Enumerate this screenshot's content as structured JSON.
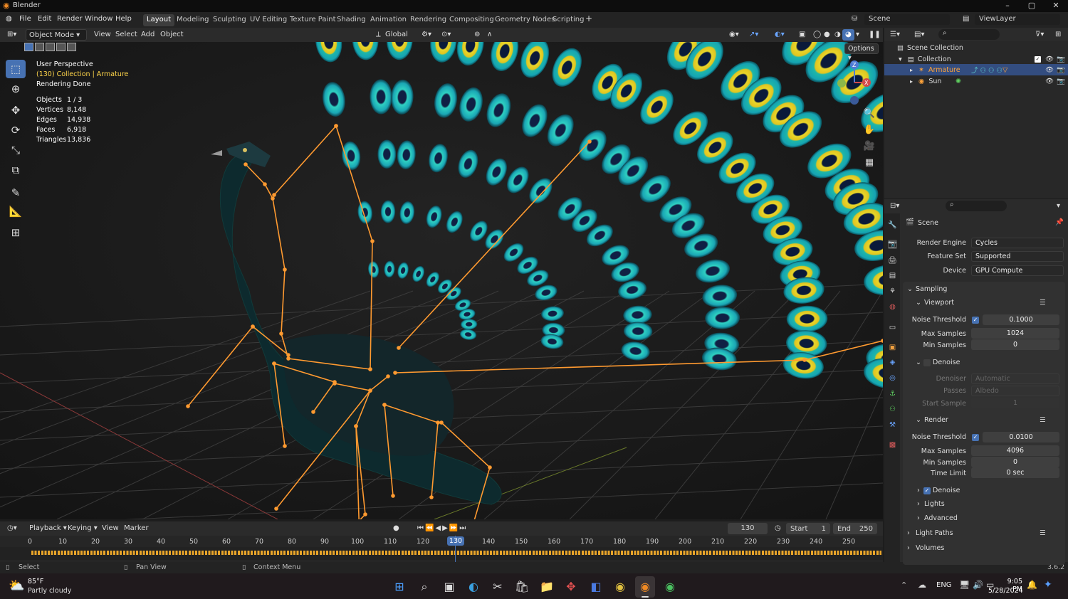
{
  "app": {
    "title": "Blender",
    "version": "3.6.2"
  },
  "menu": [
    "File",
    "Edit",
    "Render",
    "Window",
    "Help"
  ],
  "workspaces": [
    "Layout",
    "Modeling",
    "Sculpting",
    "UV Editing",
    "Texture Paint",
    "Shading",
    "Animation",
    "Rendering",
    "Compositing",
    "Geometry Nodes",
    "Scripting"
  ],
  "scene_name": "Scene",
  "view_layer": "ViewLayer",
  "viewport_header": {
    "mode": "Object Mode",
    "menus": [
      "View",
      "Select",
      "Add",
      "Object"
    ],
    "orientation": "Global",
    "options": "Options"
  },
  "overlay": {
    "view": "User Perspective",
    "collection_prefix": "(130) Collection | ",
    "active": "Armature",
    "status": "Rendering Done"
  },
  "stats": [
    {
      "label": "Objects",
      "value": "1 / 3"
    },
    {
      "label": "Vertices",
      "value": "8,148"
    },
    {
      "label": "Edges",
      "value": "14,938"
    },
    {
      "label": "Faces",
      "value": "6,918"
    },
    {
      "label": "Triangles",
      "value": "13,836"
    }
  ],
  "timeline": {
    "menus": [
      "Playback",
      "Keying",
      "View",
      "Marker"
    ],
    "current_frame": "130",
    "start_label": "Start",
    "start": "1",
    "end_label": "End",
    "end": "250",
    "ticks": [
      "0",
      "10",
      "20",
      "30",
      "40",
      "50",
      "60",
      "70",
      "80",
      "90",
      "100",
      "110",
      "120",
      "130",
      "140",
      "150",
      "160",
      "170",
      "180",
      "190",
      "200",
      "210",
      "220",
      "230",
      "240",
      "250"
    ]
  },
  "statusbar": {
    "select": "Select",
    "pan": "Pan View",
    "context": "Context Menu",
    "version": "3.6.2"
  },
  "outliner": {
    "root": "Scene Collection",
    "collection": "Collection",
    "items": [
      "Armature",
      "Sun"
    ]
  },
  "properties": {
    "scene": "Scene",
    "render_engine_label": "Render Engine",
    "render_engine": "Cycles",
    "feature_set_label": "Feature Set",
    "feature_set": "Supported",
    "device_label": "Device",
    "device": "GPU Compute",
    "sampling": "Sampling",
    "viewport": "Viewport",
    "noise_threshold_label": "Noise Threshold",
    "vp_noise": "0.1000",
    "max_samples_label": "Max Samples",
    "vp_max": "1024",
    "min_samples_label": "Min Samples",
    "vp_min": "0",
    "denoise_label": "Denoise",
    "denoiser_label": "Denoiser",
    "denoiser": "Automatic",
    "passes_label": "Passes",
    "passes": "Albedo",
    "start_sample_label": "Start Sample",
    "start_sample": "1",
    "render": "Render",
    "r_noise": "0.0100",
    "r_max": "4096",
    "r_min": "0",
    "time_limit_label": "Time Limit",
    "time_limit": "0 sec",
    "lights": "Lights",
    "advanced": "Advanced",
    "light_paths": "Light Paths",
    "volumes": "Volumes"
  },
  "taskbar": {
    "temp": "85°F",
    "weather": "Partly cloudy",
    "lang": "ENG",
    "time": "9:05 PM",
    "date": "5/28/2024"
  },
  "colors": {
    "accent": "#4772b3",
    "active_object": "#ffa33a",
    "bone": "#ff9a30",
    "feather_teal": "#22b8b8"
  }
}
